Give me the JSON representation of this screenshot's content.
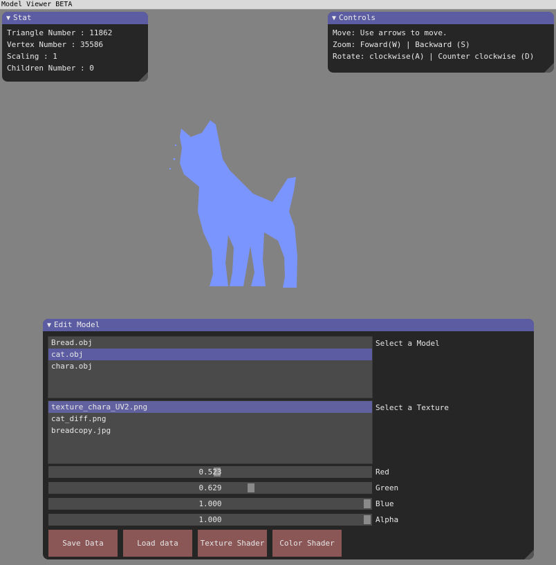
{
  "app": {
    "title": "Model Viewer BETA"
  },
  "stat": {
    "title": "Stat",
    "lines": [
      "Triangle Number : 11862",
      "Vertex Number : 35586",
      "Scaling : 1",
      "Children Number : 0"
    ]
  },
  "controls": {
    "title": "Controls",
    "lines": [
      "Move: Use arrows to move.",
      "Zoom: Foward(W) | Backward (S)",
      "Rotate: clockwise(A) | Counter clockwise (D)"
    ]
  },
  "viewport": {
    "model_color": "#7b95ff"
  },
  "edit": {
    "title": "Edit Model",
    "models": {
      "label": "Select a Model",
      "items": [
        "Bread.obj",
        "cat.obj",
        "chara.obj"
      ],
      "selected_index": 1
    },
    "textures": {
      "label": "Select a Texture",
      "items": [
        "texture_chara_UV2.png",
        "cat_diff.png",
        "breadcopy.jpg"
      ],
      "selected_index": 0
    },
    "sliders": [
      {
        "label": "Red",
        "value": "0.523",
        "fraction": 0.523
      },
      {
        "label": "Green",
        "value": "0.629",
        "fraction": 0.629
      },
      {
        "label": "Blue",
        "value": "1.000",
        "fraction": 1.0
      },
      {
        "label": "Alpha",
        "value": "1.000",
        "fraction": 1.0
      }
    ],
    "buttons": [
      "Save Data",
      "Load data",
      "Texture Shader",
      "Color Shader"
    ]
  },
  "colors": {
    "accent": "#5c5ca3",
    "button": "#8a5656",
    "window_bg": "#262626",
    "desktop": "#828282"
  }
}
